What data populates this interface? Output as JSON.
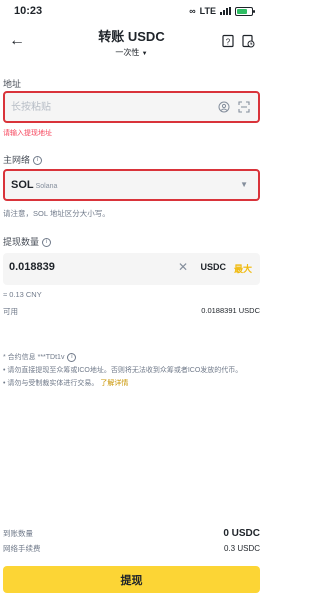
{
  "status": {
    "time": "10:23",
    "network": "LTE"
  },
  "header": {
    "title": "转账 USDC",
    "subtitle": "一次性"
  },
  "address": {
    "label": "地址",
    "placeholder": "长按粘贴",
    "error": "请输入提现地址"
  },
  "network": {
    "label": "主网络",
    "code": "SOL",
    "name": "Solana",
    "hint": "请注意，SOL 地址区分大小写。"
  },
  "amount": {
    "label": "提现数量",
    "value": "0.018839",
    "unit": "USDC",
    "max_label": "最大",
    "fiat": "≈ 0.13 CNY",
    "available_label": "可用",
    "available_value": "0.0188391 USDC"
  },
  "notes": {
    "memo": "* 合约信息 ***TDt1v",
    "line1": "• 请勿直接提现至众筹或ICO地址。否则将无法收到众筹或者ICO发放的代币。",
    "line2": "• 请勿与受制裁实体进行交易。",
    "learn_more": "了解详情"
  },
  "summary": {
    "received_label": "到账数量",
    "received_value": "0 USDC",
    "fee_label": "网络手续费",
    "fee_value": "0.3 USDC"
  },
  "submit_label": "提现",
  "colors": {
    "accent": "#fcd535",
    "link": "#c99400",
    "error": "#f6465d",
    "highlight": "#d9333a"
  }
}
